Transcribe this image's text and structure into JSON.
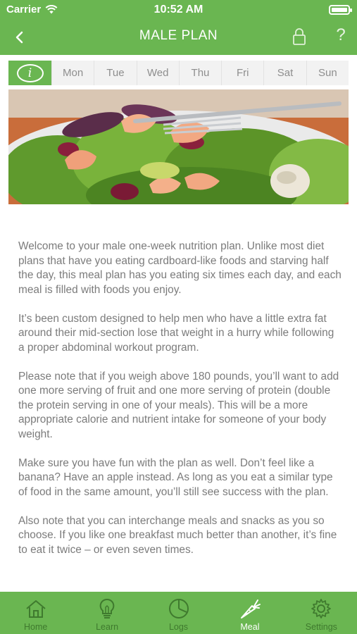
{
  "status_bar": {
    "carrier": "Carrier",
    "time": "10:52 AM"
  },
  "nav": {
    "title": "MALE PLAN"
  },
  "day_tabs": [
    "Mon",
    "Tue",
    "Wed",
    "Thu",
    "Fri",
    "Sat",
    "Sun"
  ],
  "info_tab": {
    "glyph": "i"
  },
  "article": {
    "paragraphs": [
      "Welcome to your male one-week nutrition plan. Unlike most diet plans that have you eating cardboard-like foods and starving half the day, this meal plan has you eating six times each day, and each meal is filled with foods you enjoy.",
      "It’s been custom designed to help men who have a little extra fat around their mid-section lose that weight in a hurry while following a proper abdominal workout program.",
      "Please note that if you weigh above 180 pounds, you’ll want to add one more serving of fruit and one more serving of protein (double the protein serving in one of your meals). This will be a more appropriate calorie and nutrient intake for someone of your body weight.",
      "Make sure you have fun with the plan as well. Don’t feel like a banana? Have an apple instead. As long as you eat a similar type of food in the same amount, you’ll still see success with the plan.",
      "Also note that you can interchange meals and snacks as you so choose. If you like one breakfast much better than another, it’s fine to eat it twice – or even seven times."
    ]
  },
  "tab_bar": {
    "active": "Meal",
    "items": [
      {
        "label": "Home",
        "icon": "home-icon"
      },
      {
        "label": "Learn",
        "icon": "lightbulb-icon"
      },
      {
        "label": "Logs",
        "icon": "pie-chart-icon"
      },
      {
        "label": "Meal",
        "icon": "carrot-icon"
      },
      {
        "label": "Settings",
        "icon": "gear-icon"
      }
    ]
  },
  "colors": {
    "brand_green": "#6ab651",
    "tab_inactive": "#3f7a2e",
    "body_text": "#7b7b7b",
    "tab_strip_bg": "#f2f2f2"
  }
}
